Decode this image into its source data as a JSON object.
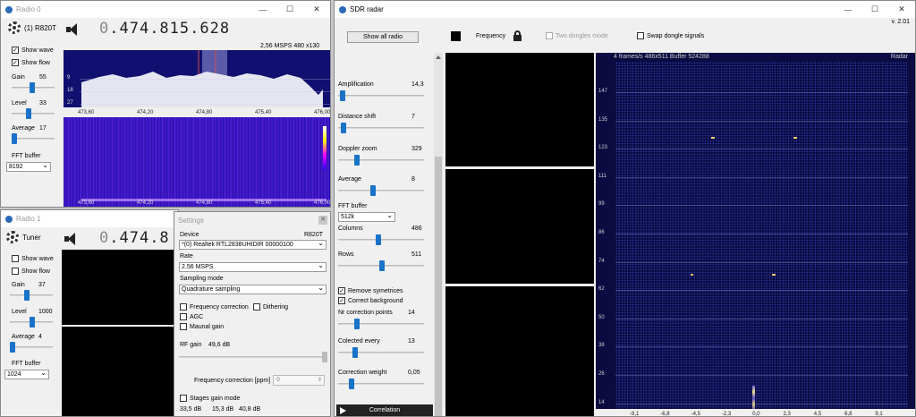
{
  "radio0": {
    "title": "Radio 0",
    "device_btn": "(1) R820T",
    "freq_int": "0",
    "freq_rest": ".474.815.628",
    "info": "2,56 MSPS 480 x130",
    "show_wave": "Show wave",
    "show_flow": "Show flow",
    "gain_label": "Gain",
    "gain_val": "55",
    "level_label": "Level",
    "level_val": "33",
    "avg_label": "Average",
    "avg_val": "17",
    "fft_label": "FFT buffer",
    "fft_val": "8192",
    "y_ticks": [
      "9",
      "18",
      "27"
    ],
    "x_ticks": [
      "473,60",
      "474,20",
      "474,80",
      "475,40",
      "476,00"
    ]
  },
  "radio1": {
    "title": "Radio 1",
    "device_btn": "Tuner",
    "freq_int": "0",
    "freq_rest": ".474.8",
    "show_wave": "Show wave",
    "show_flow": "Show flow",
    "gain_label": "Gain",
    "gain_val": "37",
    "level_label": "Level",
    "level_val": "1000",
    "avg_label": "Average",
    "avg_val": "4",
    "fft_label": "FFT buffer",
    "fft_val": "1024"
  },
  "settings": {
    "title": "Settings",
    "device_label": "Device",
    "device_model": "R820T",
    "device_val": "*(0) Realtek RTL2838UHIDIR 00000100",
    "rate_label": "Rate",
    "rate_val": "2.56 MSPS",
    "sampling_label": "Sampling mode",
    "sampling_val": "Quadrature sampling",
    "freq_corr": "Frequency correction",
    "dithering": "Dithering",
    "agc": "AGC",
    "manual_gain": "Maunal gain",
    "rf_gain_label": "RF gain",
    "rf_gain_val": "49,6 dB",
    "freq_corr_ppm": "Frequency correction [ppm]",
    "ppm_val": "0",
    "stages": "Stages gain mode",
    "stage_vals": [
      "33,5 dB",
      "15,3 dB",
      "40,8 dB"
    ]
  },
  "radar": {
    "title": "SDR radar",
    "version": "v. 2.01",
    "show_all": "Show all radio",
    "frequency": "Frequency",
    "two_dongles": "Two dongles mode",
    "swap": "Swap dongle signals",
    "amp_label": "Amplification",
    "amp_val": "14,3",
    "dist_label": "Distance shift",
    "dist_val": "7",
    "dop_label": "Doppler zoom",
    "dop_val": "329",
    "avg_label": "Average",
    "avg_val": "8",
    "fft_label": "FFT buffer",
    "fft_val": "512k",
    "cols_label": "Columns",
    "cols_val": "486",
    "rows_label": "Rows",
    "rows_val": "511",
    "remove_sym": "Remove symetrices",
    "correct_bg": "Correct background",
    "nr_corr": "Nr correction points",
    "nr_corr_val": "14",
    "collected": "Colected every",
    "collected_val": "13",
    "corr_weight": "Correction weight",
    "corr_weight_val": "0,05",
    "correlation": "Correlation",
    "status": "4 frames/s   486x511 Buffer 524288",
    "mode": "Radar",
    "y_ticks": [
      "147",
      "135",
      "123",
      "111",
      "99",
      "86",
      "74",
      "62",
      "50",
      "38",
      "26",
      "14"
    ],
    "x_ticks": [
      "-9,1",
      "-6,8",
      "-4,5",
      "-2,3",
      "0,0",
      "2,3",
      "4,5",
      "6,8",
      "9,1"
    ]
  },
  "colors": {
    "spectrum_bg": "#1a1a8c",
    "waterfall": "#3a1ad0",
    "radar_bg": "#0a0a4a"
  }
}
